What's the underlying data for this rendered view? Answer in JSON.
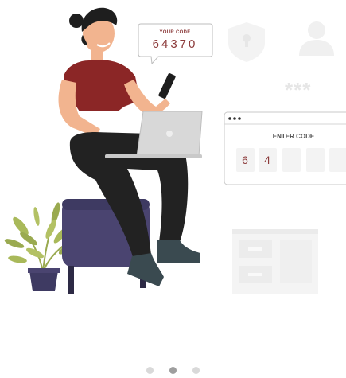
{
  "onboarding": {
    "bubble": {
      "label": "YOUR CODE",
      "code": "64370"
    },
    "code_panel": {
      "title": "ENTER CODE",
      "digits": [
        "6",
        "4",
        "_",
        "",
        ""
      ]
    },
    "masked_password": "***",
    "pagination": {
      "total": 3,
      "active_index": 1
    }
  },
  "colors": {
    "accent": "#8c3b3b",
    "shirt": "#8b2626",
    "pants": "#222222",
    "stool": "#4a4470",
    "plant": "#9aaa50",
    "inactive_dot": "#d9d9d9",
    "active_dot": "#9e9e9e"
  }
}
